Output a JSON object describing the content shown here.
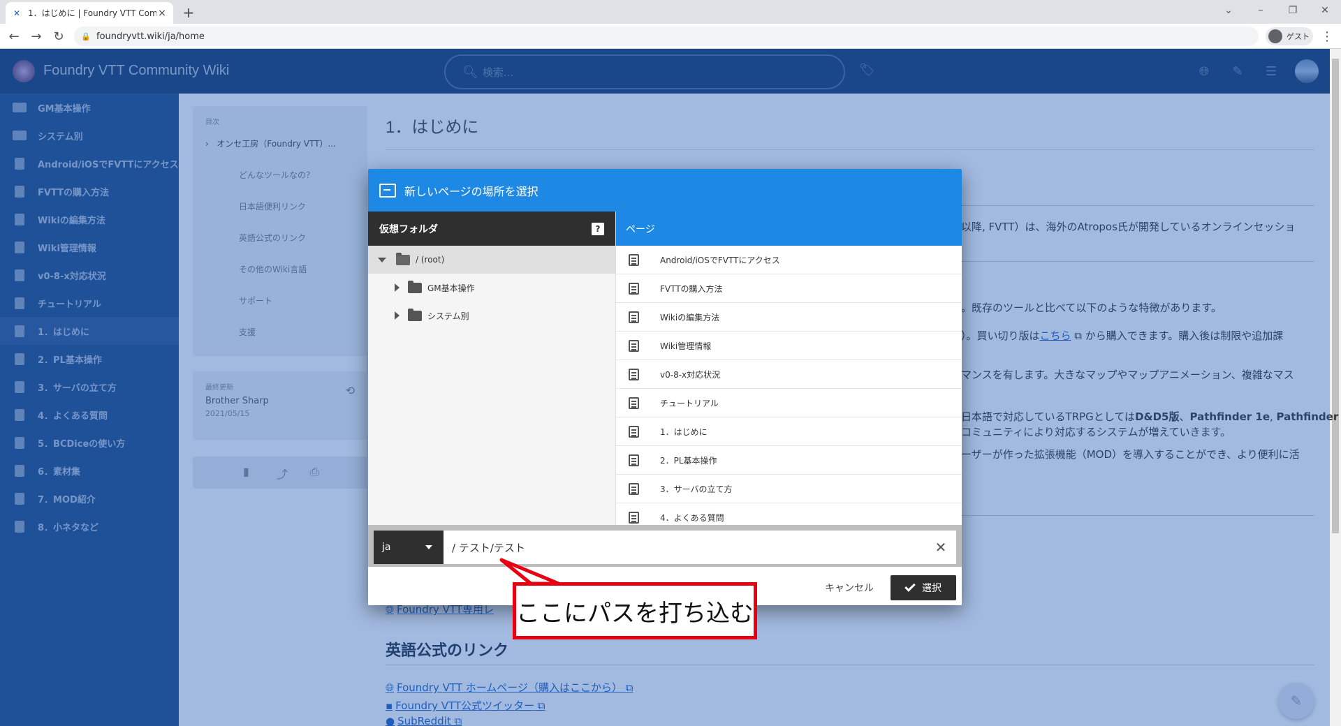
{
  "browser": {
    "tab_title": "1．はじめに | Foundry VTT Comm",
    "url": "foundryvtt.wiki/ja/home",
    "profile_label": "ゲスト"
  },
  "app": {
    "title": "Foundry VTT Community Wiki",
    "search_placeholder": "検索..."
  },
  "sidebar": {
    "items": [
      {
        "label": "GM基本操作",
        "icon": "folder-icon"
      },
      {
        "label": "システム別",
        "icon": "folder-icon"
      },
      {
        "label": "Android/iOSでFVTTにアクセス",
        "icon": "document-icon"
      },
      {
        "label": "FVTTの購入方法",
        "icon": "document-icon"
      },
      {
        "label": "Wikiの編集方法",
        "icon": "document-icon"
      },
      {
        "label": "Wiki管理情報",
        "icon": "document-icon"
      },
      {
        "label": "v0-8-x対応状況",
        "icon": "document-icon"
      },
      {
        "label": "チュートリアル",
        "icon": "document-icon"
      },
      {
        "label": "1．はじめに",
        "icon": "document-icon"
      },
      {
        "label": "2．PL基本操作",
        "icon": "document-icon"
      },
      {
        "label": "3．サーバの立て方",
        "icon": "document-icon"
      },
      {
        "label": "4．よくある質問",
        "icon": "document-icon"
      },
      {
        "label": "5．BCDiceの使い方",
        "icon": "document-icon"
      },
      {
        "label": "6．素材集",
        "icon": "document-icon"
      },
      {
        "label": "7．MOD紹介",
        "icon": "document-icon"
      },
      {
        "label": "8．小ネタなど",
        "icon": "document-icon"
      }
    ]
  },
  "toc": {
    "label": "目次",
    "top": "オンセ工房（Foundry VTT）...",
    "subs": [
      "どんなツールなの？",
      "日本語便利リンク",
      "英語公式のリンク",
      "その他のWiki言語",
      "サポート",
      "支援"
    ]
  },
  "last_edit": {
    "label": "最終更新",
    "author": "Brother Sharp",
    "date": "2021/05/15"
  },
  "page": {
    "title": "1．はじめに",
    "snippets": [
      "以降, FVTT）は、海外のAtropos氏が開発しているオンラインセッショ",
      "。既存のツールと比べて以下のような特徴があります。",
      "）。買い切り版は",
      "こちら",
      "から購入できます。購入後は制限や追加課",
      "マンスを有します。大きなマップやマップアニメーション、複雑なマス",
      "日本語で対応しているTRPGとしては",
      "D&D5版",
      "、",
      "Pathfinder 1e",
      ", ",
      "Pathfinder",
      "コミュニティにより対応するシステムが増えていきます。",
      "ーザーが作った拡張機能（MOD）を導入することができ、より便利に活"
    ],
    "link_partial": "Foundry VTT専用レ",
    "section_heading": "英語公式のリンク",
    "links": [
      "Foundry VTT ホームページ（購入はここから）",
      "Foundry VTT公式ツイッター",
      "SubReddit"
    ]
  },
  "dialog": {
    "title": "新しいページの場所を選択",
    "folders_header": "仮想フォルダ",
    "help_label": "?",
    "pages_header": "ページ",
    "tree_root": "/ (root)",
    "tree_items": [
      "GM基本操作",
      "システム別"
    ],
    "pages": [
      "Android/iOSでFVTTにアクセス",
      "FVTTの購入方法",
      "Wikiの編集方法",
      "Wiki管理情報",
      "v0-8-x対応状況",
      "チュートリアル",
      "1．はじめに",
      "2．PL基本操作",
      "3．サーバの立て方",
      "4．よくある質問"
    ],
    "locale": "ja",
    "path_value": "/ テスト/テスト",
    "cancel_label": "キャンセル",
    "select_label": "選択"
  },
  "annotation": {
    "callout_text": "ここにパスを打ち込む",
    "color": "#e60012"
  },
  "colors": {
    "header_blue": "#1e88e5",
    "sidebar": "#1e4a86",
    "appbar": "#163a6c"
  }
}
